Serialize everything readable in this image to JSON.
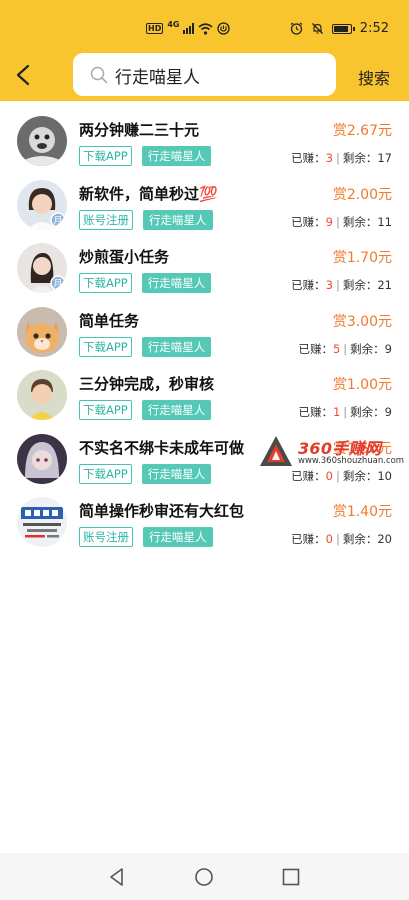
{
  "status_bar": {
    "network": "HD",
    "signal": "4G",
    "time": "2:52"
  },
  "header": {
    "search_value": "行走喵星人",
    "search_button": "搜索"
  },
  "stats_labels": {
    "earned": "已赚：",
    "remaining": "剩余："
  },
  "tasks": [
    {
      "title": "两分钟赚二三十元",
      "reward": "赏2.67元",
      "tag1": "下载APP",
      "tag2": "行走喵星人",
      "earned": "3",
      "remaining": "17"
    },
    {
      "title": "新软件，简单秒过💯",
      "reward": "赏2.00元",
      "tag1": "账号注册",
      "tag2": "行走喵星人",
      "earned": "9",
      "remaining": "11"
    },
    {
      "title": "炒煎蛋小任务",
      "reward": "赏1.70元",
      "tag1": "下载APP",
      "tag2": "行走喵星人",
      "earned": "3",
      "remaining": "21"
    },
    {
      "title": "简单任务",
      "reward": "赏3.00元",
      "tag1": "下载APP",
      "tag2": "行走喵星人",
      "earned": "5",
      "remaining": "9"
    },
    {
      "title": "三分钟完成，秒审核",
      "reward": "赏1.00元",
      "tag1": "下载APP",
      "tag2": "行走喵星人",
      "earned": "1",
      "remaining": "9"
    },
    {
      "title": "不实名不绑卡未成年可做",
      "reward": "赏1.50元",
      "tag1": "下载APP",
      "tag2": "行走喵星人",
      "earned": "0",
      "remaining": "10"
    },
    {
      "title": "简单操作秒审还有大红包",
      "reward": "赏1.40元",
      "tag1": "账号注册",
      "tag2": "行走喵星人",
      "earned": "0",
      "remaining": "20"
    }
  ],
  "watermark": {
    "brand": "360手赚网",
    "url": "www.360shouzhuan.com"
  },
  "colors": {
    "header_bg": "#f9c52f",
    "reward": "#f07a2e",
    "tag": "#55c9b6",
    "count": "#f04a2e"
  }
}
